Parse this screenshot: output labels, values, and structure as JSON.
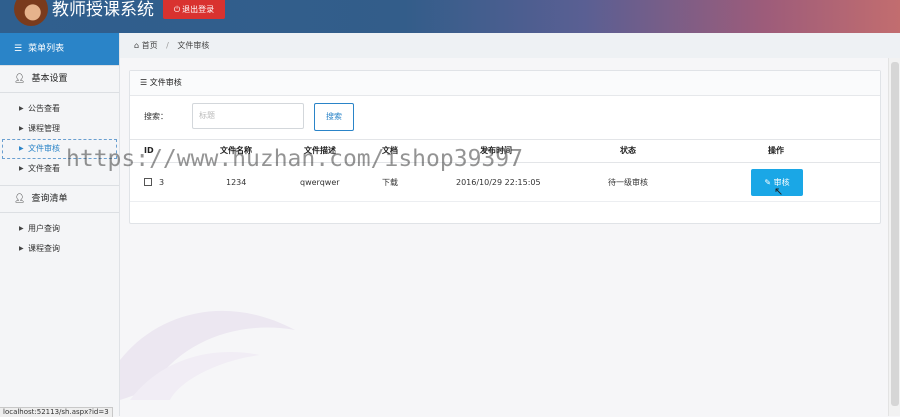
{
  "header": {
    "title": "教师授课系统",
    "logout_label": "退出登录"
  },
  "sidebar": {
    "menu_title": "菜单列表",
    "groups": [
      {
        "title": "基本设置",
        "items": [
          {
            "label": "公告查看"
          },
          {
            "label": "课程管理"
          },
          {
            "label": "文件审核"
          },
          {
            "label": "文件查看"
          }
        ]
      },
      {
        "title": "查询清单",
        "items": [
          {
            "label": "用户查询"
          },
          {
            "label": "课程查询"
          }
        ]
      }
    ]
  },
  "breadcrumb": {
    "home": "首页",
    "current": "文件审核"
  },
  "panel": {
    "title": "文件审核",
    "search_label": "搜索：",
    "search_placeholder": "标题",
    "search_button": "搜索"
  },
  "table": {
    "headers": [
      "ID",
      "文件名称",
      "文件描述",
      "文档",
      "发布时间",
      "状态",
      "操作"
    ],
    "rows": [
      {
        "id": "3",
        "name": "1234",
        "description": "qwerqwer",
        "document": "下载",
        "time": "2016/10/29 22:15:05",
        "status": "待一级审核",
        "action": "审核"
      }
    ]
  },
  "watermark": "https://www.huzhan.com/ishop39397",
  "status_bar": "localhost:52113/sh.aspx?id=3",
  "colors": {
    "accent": "#2a84c8",
    "logout": "#d9322f",
    "audit_button": "#1aa7e6"
  }
}
